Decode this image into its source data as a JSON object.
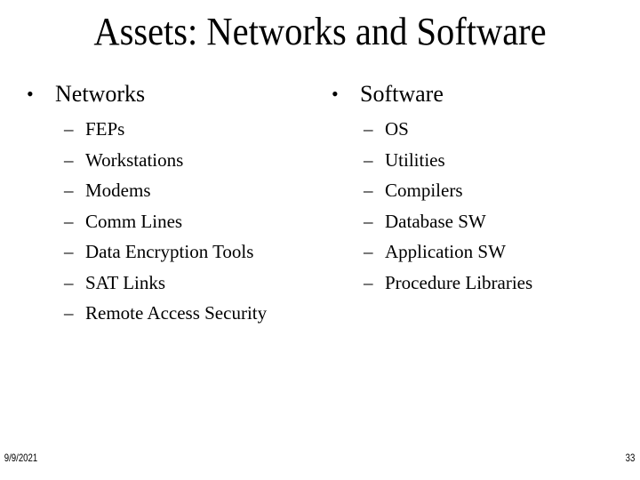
{
  "slide": {
    "title": "Assets: Networks and Software",
    "bullet_glyph": "•",
    "dash_glyph": "–",
    "columns": [
      {
        "heading": "Networks",
        "items": [
          "FEPs",
          "Workstations",
          "Modems",
          "Comm Lines",
          "Data Encryption Tools",
          "SAT Links",
          "Remote Access Security"
        ]
      },
      {
        "heading": "Software",
        "items": [
          "OS",
          "Utilities",
          "Compilers",
          "Database SW",
          "Application SW",
          "Procedure Libraries"
        ]
      }
    ],
    "footer": {
      "date": "9/9/2021",
      "page_number": "33"
    }
  }
}
